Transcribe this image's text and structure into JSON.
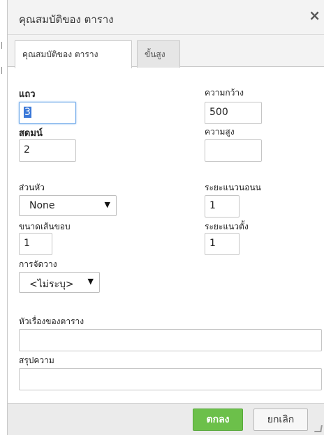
{
  "dialog": {
    "title": "คุณสมบัติของ ตาราง",
    "close_symbol": "×"
  },
  "tabs": [
    {
      "label": "คุณสมบัติของ ตาราง",
      "active": true
    },
    {
      "label": "ขั้นสูง",
      "active": false
    }
  ],
  "fields": {
    "rows": {
      "label": "แถว",
      "value": "3"
    },
    "columns": {
      "label": "สดมน์",
      "value": "2"
    },
    "width": {
      "label": "ความกว้าง",
      "value": "500"
    },
    "height": {
      "label": "ความสูง",
      "value": ""
    },
    "headers": {
      "label": "ส่วนหัว",
      "value": "None"
    },
    "cell_spacing": {
      "label": "ระยะแนวนอนน",
      "value": "1"
    },
    "border_size": {
      "label": "ขนาดเส้นขอบ",
      "value": "1"
    },
    "cell_padding": {
      "label": "ระยะแนวตั้ง",
      "value": "1"
    },
    "alignment": {
      "label": "การจัดวาง",
      "value": "<ไม่ระบุ>"
    },
    "caption": {
      "label": "หัวเรื่องของตาราง",
      "value": ""
    },
    "summary": {
      "label": "สรุปความ",
      "value": ""
    }
  },
  "buttons": {
    "ok": "ตกลง",
    "cancel": "ยกเลิก"
  },
  "colors": {
    "ok_button": "#6cc04a",
    "focus_border": "#6aa6e8",
    "selection": "#3a78d8"
  }
}
